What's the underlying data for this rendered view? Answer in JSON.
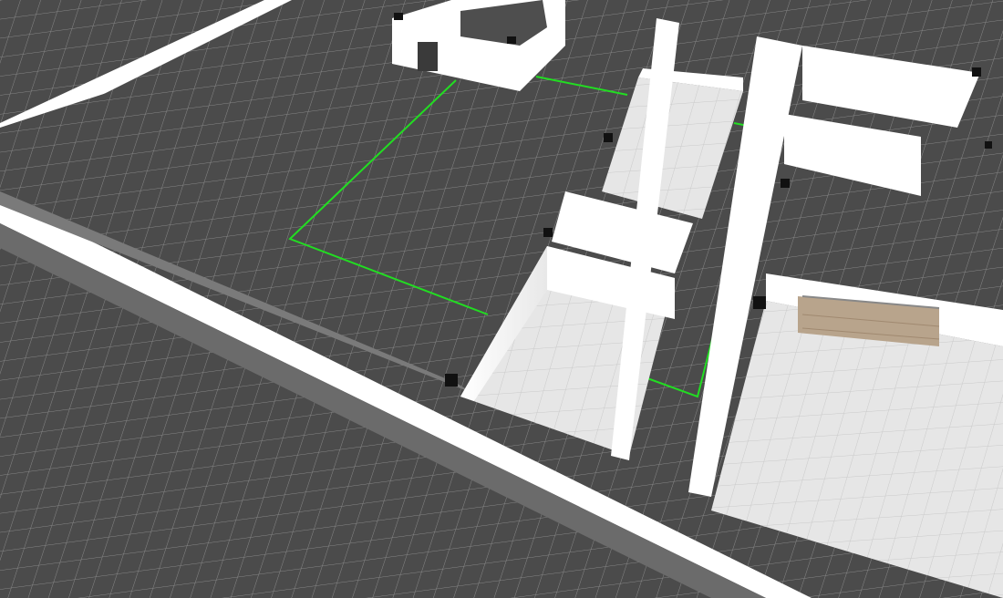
{
  "view": {
    "type": "3d-floorplan-viewport",
    "projection": "perspective",
    "background_color": "#5a5a5a",
    "outdoor_floor_color": "#4b4b4b",
    "interior_floor_color": "#e6e6e6",
    "wall_color": "#ffffff",
    "grid_line_color": "#8a8a8a",
    "selection_outline_color": "#22dd22"
  },
  "rooms": [
    {
      "id": "large-dark-zone",
      "floor": "dark-grid"
    },
    {
      "id": "top-room",
      "floor": "white-walls"
    },
    {
      "id": "room-a",
      "floor": "light-tile"
    },
    {
      "id": "room-b",
      "floor": "light-tile"
    },
    {
      "id": "room-c",
      "floor": "light-tile"
    },
    {
      "id": "corridor",
      "floor": "dark-grid"
    },
    {
      "id": "right-rooms",
      "floor": "light-tile"
    }
  ],
  "objects": [
    {
      "id": "door",
      "icon": "door-icon"
    },
    {
      "id": "staircase",
      "icon": "stairs-icon"
    }
  ]
}
